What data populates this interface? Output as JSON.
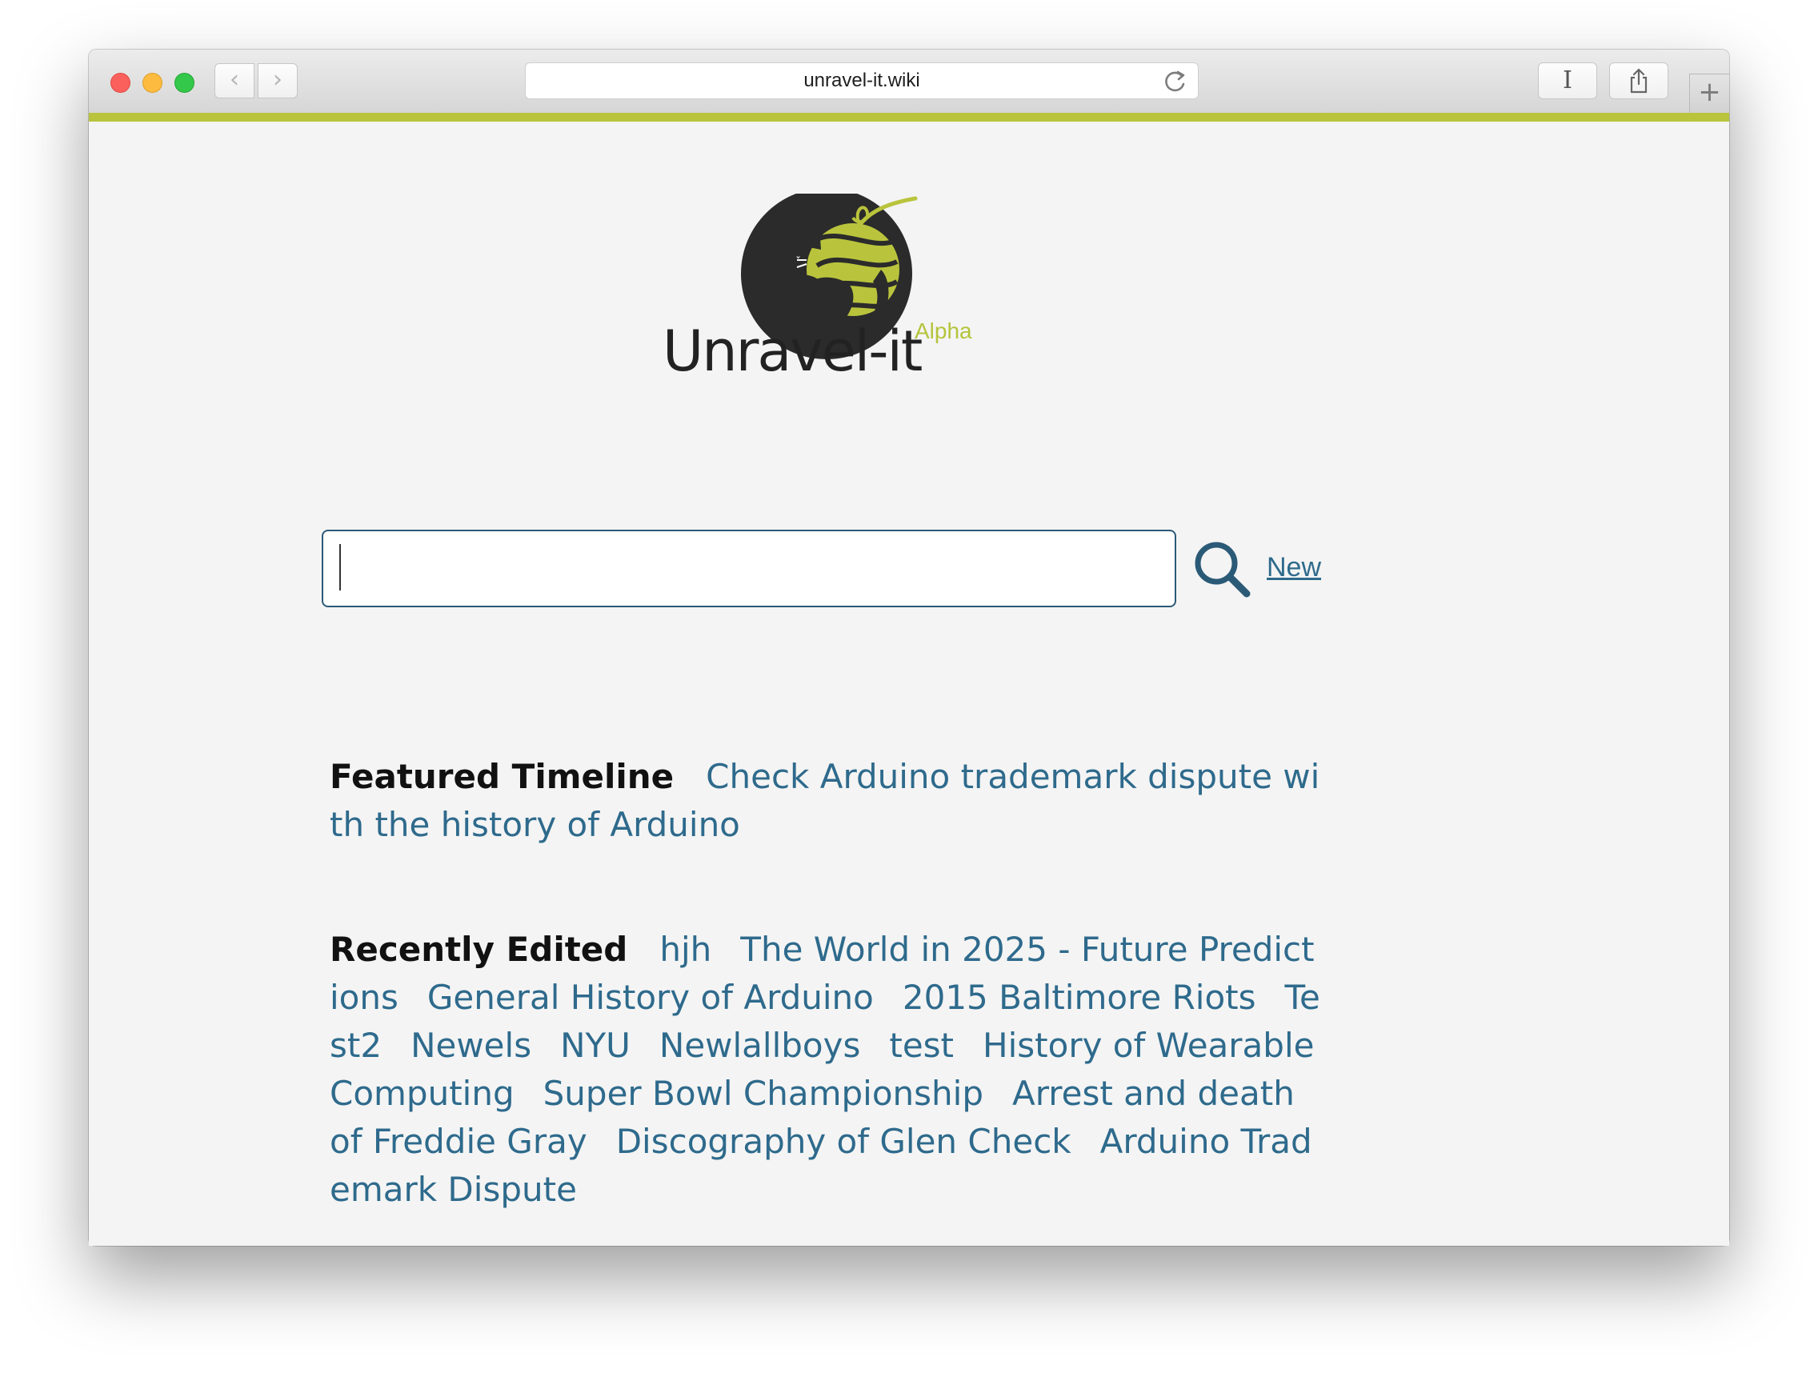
{
  "browser": {
    "url": "unravel-it.wiki",
    "back_glyph": "‹",
    "forward_glyph": "›",
    "reader_glyph": "I",
    "new_tab_glyph": "+"
  },
  "brand": {
    "name": "Unravel-it",
    "badge": "Alpha",
    "accent_color": "#b9c43c",
    "link_color": "#2e6a8c"
  },
  "search": {
    "value": "",
    "placeholder": "",
    "new_label": "New"
  },
  "featured": {
    "label": "Featured Timeline",
    "link": "Check Arduino trademark dispute with the history of Arduino"
  },
  "recent": {
    "label": "Recently Edited",
    "items": [
      "hjh",
      "The World in 2025 - Future Predictions",
      "General History of Arduino",
      "2015 Baltimore Riots",
      "Test2",
      "Newels",
      "NYU",
      "Newlallboys",
      "test",
      "History of Wearable Computing",
      "Super Bowl Championship",
      "Arrest and death of Freddie Gray",
      "Discography of Glen Check",
      "Arduino Trademark Dispute"
    ]
  }
}
